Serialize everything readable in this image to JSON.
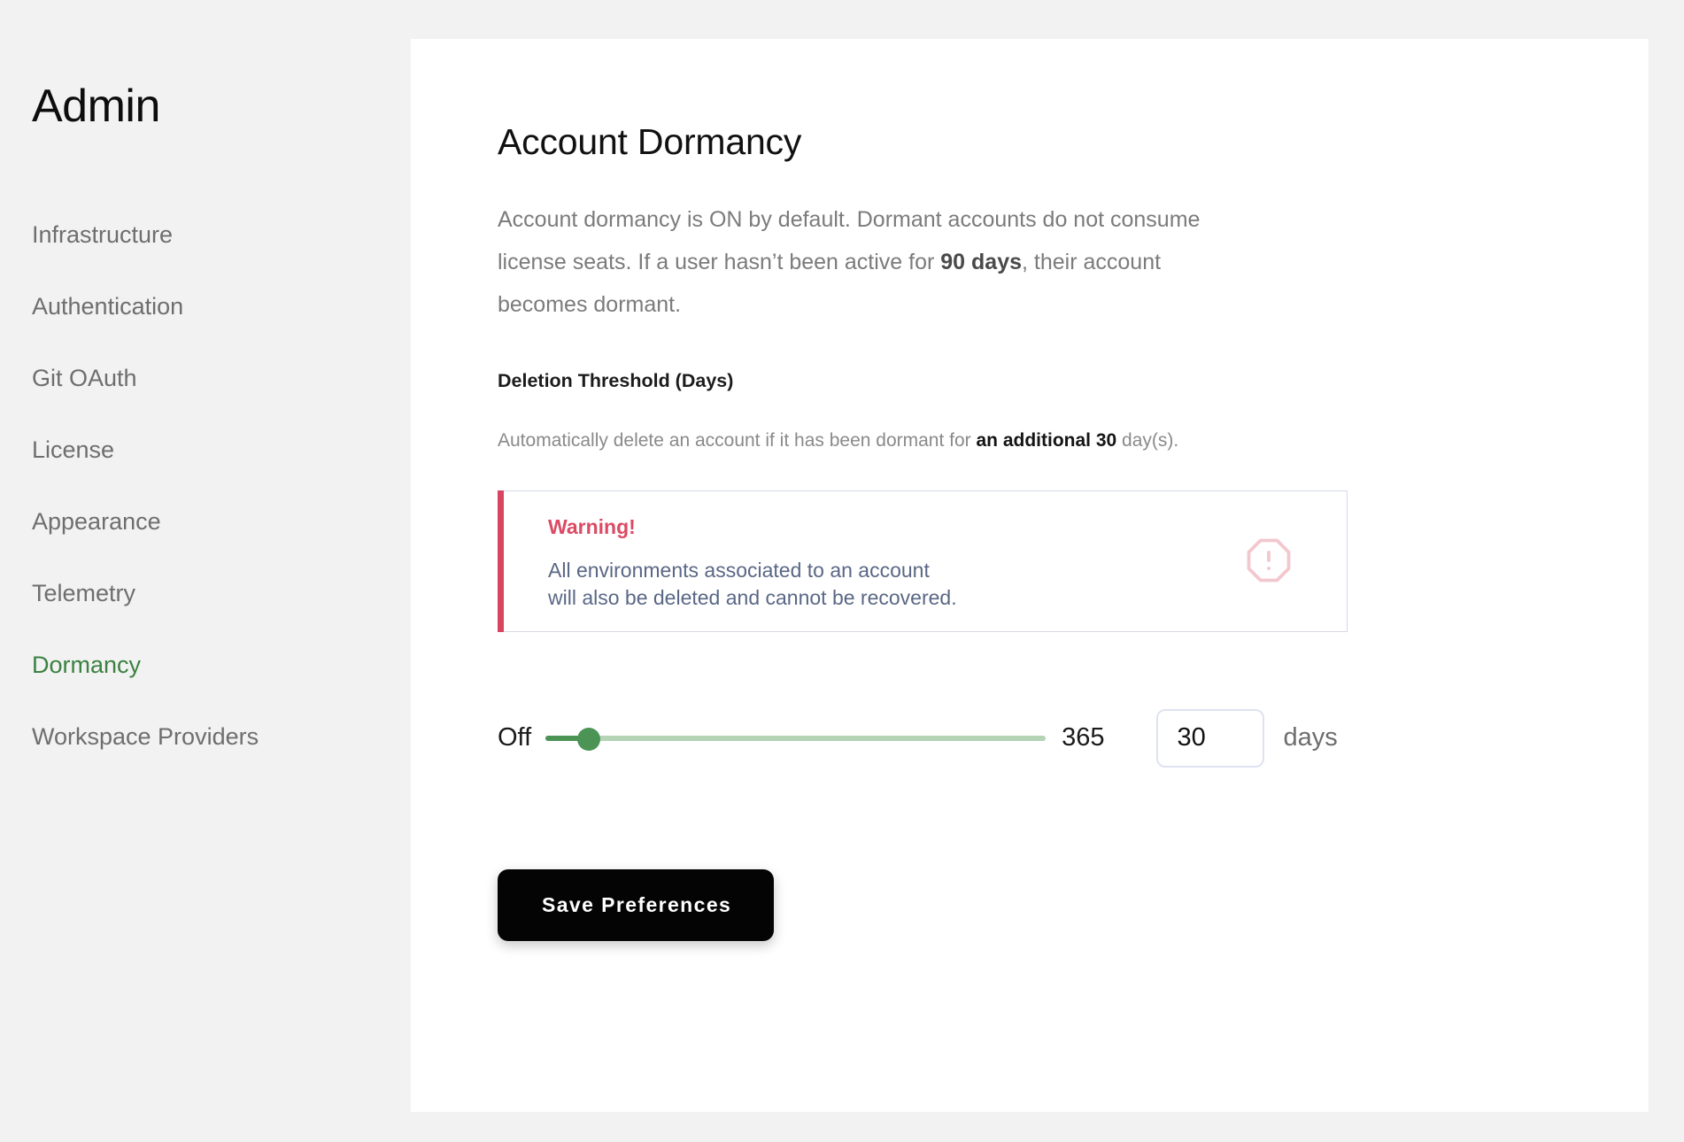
{
  "sidebar": {
    "title": "Admin",
    "items": [
      {
        "label": "Infrastructure",
        "active": false
      },
      {
        "label": "Authentication",
        "active": false
      },
      {
        "label": "Git OAuth",
        "active": false
      },
      {
        "label": "License",
        "active": false
      },
      {
        "label": "Appearance",
        "active": false
      },
      {
        "label": "Telemetry",
        "active": false
      },
      {
        "label": "Dormancy",
        "active": true
      },
      {
        "label": "Workspace Providers",
        "active": false
      }
    ],
    "active_color": "#3c8141",
    "inactive_color": "#6e6e6e"
  },
  "main": {
    "page_title": "Account Dormancy",
    "intro": {
      "part1": "Account dormancy is ON by default. Dormant accounts do not consume license seats. If a user hasn’t been active for ",
      "highlight": "90 days",
      "part2": ", their account becomes dormant."
    },
    "section_label": "Deletion Threshold (Days)",
    "helper": {
      "part1": "Automatically delete an account if it has been dormant for ",
      "highlight": "an additional 30",
      "part2": " day(s)."
    },
    "warning": {
      "title": "Warning!",
      "body": "All environments associated to an account\nwill also be deleted and cannot be recovered.",
      "icon": "alert-octagon-icon",
      "accent_color": "#d94560",
      "title_color": "#dc4a64",
      "body_color": "#5a6785",
      "border_color": "#d6dae8"
    },
    "slider": {
      "min_label": "Off",
      "max_label": "365",
      "min_value": 0,
      "max_value": 365,
      "value": 30,
      "fill_color": "#4b9455",
      "track_color": "#b5d3b5"
    },
    "days_input": {
      "value": "30",
      "placeholder": "30",
      "unit_label": "days"
    },
    "save_button": {
      "label": "Save Preferences"
    }
  }
}
